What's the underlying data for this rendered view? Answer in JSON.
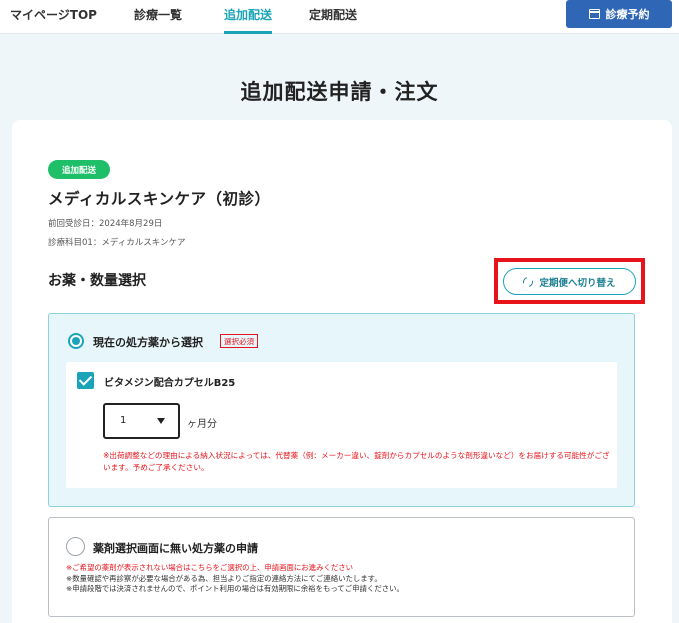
{
  "nav": {
    "items": [
      {
        "label": "マイページTOP"
      },
      {
        "label": "診療一覧"
      },
      {
        "label": "追加配送"
      },
      {
        "label": "定期配送"
      }
    ],
    "active_index": 2,
    "reserve_button": "診療予約"
  },
  "page": {
    "title": "追加配送申請・注文"
  },
  "course": {
    "badge": "追加配送",
    "title": "メディカルスキンケア（初診）",
    "last_visit": "前回受診日：2024年8月29日",
    "department": "診療科目01：メディカルスキンケア"
  },
  "medicine": {
    "section_title": "お薬・数量選択",
    "switch_button": "定期便へ切り替え",
    "option_current": {
      "label": "現在の処方薬から選択",
      "required_tag": "選択必須",
      "selected": true,
      "drug": {
        "name": "ビタメジン配合カプセルB25",
        "checked": true,
        "quantity": "1",
        "unit": "ヶ月分"
      },
      "note": "※出荷調整などの理由による納入状況によっては、代替薬（例：メーカー違い、錠剤からカプセルのような剤形違いなど）をお届けする可能性がございます。予めご了承ください。"
    },
    "option_other": {
      "label": "薬剤選択画面に無い処方薬の申請",
      "selected": false,
      "note_red": "※ご希望の薬剤が表示されない場合はこちらをご選択の上、申請画面にお進みください",
      "note_1": "※数量確認や再診察が必要な場合がある為、担当よりご指定の連絡方法にてご連絡いたします。",
      "note_2": "※申請段階では決済されませんので、ポイント利用の場合は有効期限に余裕をもってご申請ください。"
    }
  },
  "colors": {
    "accent": "#1ba4b8",
    "primary_button": "#2f66b6",
    "badge": "#1fbf6a",
    "alert": "#e8141b",
    "background": "#eef6fa"
  }
}
